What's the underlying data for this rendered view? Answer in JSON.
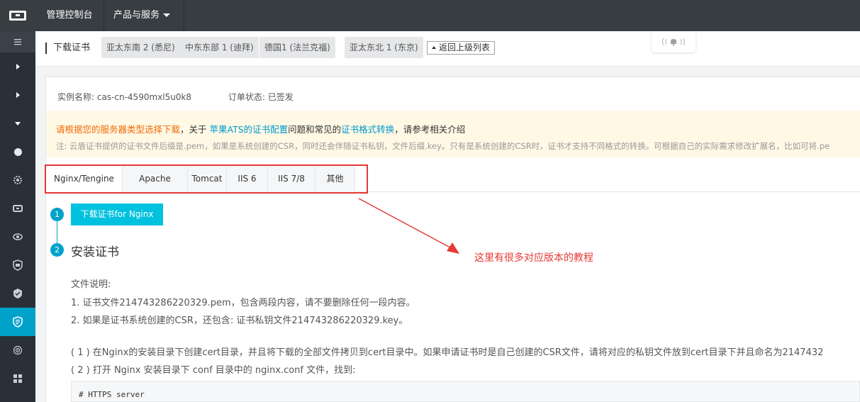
{
  "topbar": {
    "console": "管理控制台",
    "products": "产品与服务"
  },
  "header": {
    "title": "下载证书",
    "regions": [
      "亚太东南 2 (悉尼)",
      "中东东部 1 (迪拜)",
      "德国1 (法兰克福)",
      "亚太东北 1 (东京)"
    ],
    "back": "返回上级列表",
    "bell_label": "((🔔))"
  },
  "instance": {
    "name": "实例名称: cas-cn-4590mxl5u0k8",
    "status": "订单状态: 已签发"
  },
  "notice": {
    "part1": "请根据您的服务器类型选择下载",
    "part2": "，关于 ",
    "link1": "苹果ATS的证书配置",
    "part3": "问题和常见的",
    "link2": "证书格式转换",
    "part4": "，请参考相关介绍",
    "note": "注: 云盾证书提供的证书文件后缀是.pem，如果是系统创建的CSR，同时还会伴随证书私钥，文件后缀.key。只有是系统创建的CSR时，证书才支持不同格式的转换。可根据自己的实际需求修改扩展名，比如可将.pe"
  },
  "tabs": [
    "Nginx/Tengine",
    "Apache",
    "Tomcat",
    "IIS 6",
    "IIS 7/8",
    "其他"
  ],
  "steps": {
    "one": "1",
    "two": "2",
    "download": "下载证书for Nginx",
    "install_title": "安装证书"
  },
  "annotation": "这里有很多对应版本的教程",
  "content": {
    "file_desc": "文件说明:",
    "line1": "1. 证书文件214743286220329.pem，包含两段内容，请不要删除任何一段内容。",
    "line2": "2. 如果是证书系统创建的CSR，还包含: 证书私钥文件214743286220329.key。",
    "line3": "( 1 ) 在Nginx的安装目录下创建cert目录，并且将下载的全部文件拷贝到cert目录中。如果申请证书时是自己创建的CSR文件，请将对应的私钥文件放到cert目录下并且命名为2147432",
    "line4": "( 2 ) 打开 Nginx 安装目录下 conf 目录中的 nginx.conf 文件，找到:",
    "code": "# HTTPS server"
  },
  "colors": {
    "topbar": "#373d41",
    "sidebar": "#293038",
    "accent": "#00a2ca",
    "button": "#00c1de",
    "annotation": "#e53935",
    "notice_bg": "#fff8e5"
  }
}
